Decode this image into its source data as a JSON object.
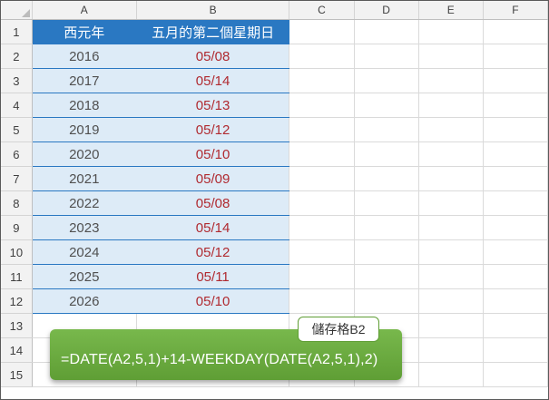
{
  "columns": [
    "A",
    "B",
    "C",
    "D",
    "E",
    "F"
  ],
  "headers": {
    "a": "西元年",
    "b": "五月的第二個星期日"
  },
  "rows": [
    {
      "num": "1"
    },
    {
      "num": "2",
      "year": "2016",
      "date": "05/08"
    },
    {
      "num": "3",
      "year": "2017",
      "date": "05/14"
    },
    {
      "num": "4",
      "year": "2018",
      "date": "05/13"
    },
    {
      "num": "5",
      "year": "2019",
      "date": "05/12"
    },
    {
      "num": "6",
      "year": "2020",
      "date": "05/10"
    },
    {
      "num": "7",
      "year": "2021",
      "date": "05/09"
    },
    {
      "num": "8",
      "year": "2022",
      "date": "05/08"
    },
    {
      "num": "9",
      "year": "2023",
      "date": "05/14"
    },
    {
      "num": "10",
      "year": "2024",
      "date": "05/12"
    },
    {
      "num": "11",
      "year": "2025",
      "date": "05/11"
    },
    {
      "num": "12",
      "year": "2026",
      "date": "05/10"
    },
    {
      "num": "13"
    },
    {
      "num": "14"
    },
    {
      "num": "15"
    }
  ],
  "callout": {
    "tag": "儲存格B2",
    "formula": "=DATE(A2,5,1)+14-WEEKDAY(DATE(A2,5,1),2)"
  },
  "colors": {
    "header_fill": "#2a78c2",
    "data_fill": "#ddebf7",
    "date_text": "#b02a30",
    "callout_fill": "#6aab3f"
  }
}
